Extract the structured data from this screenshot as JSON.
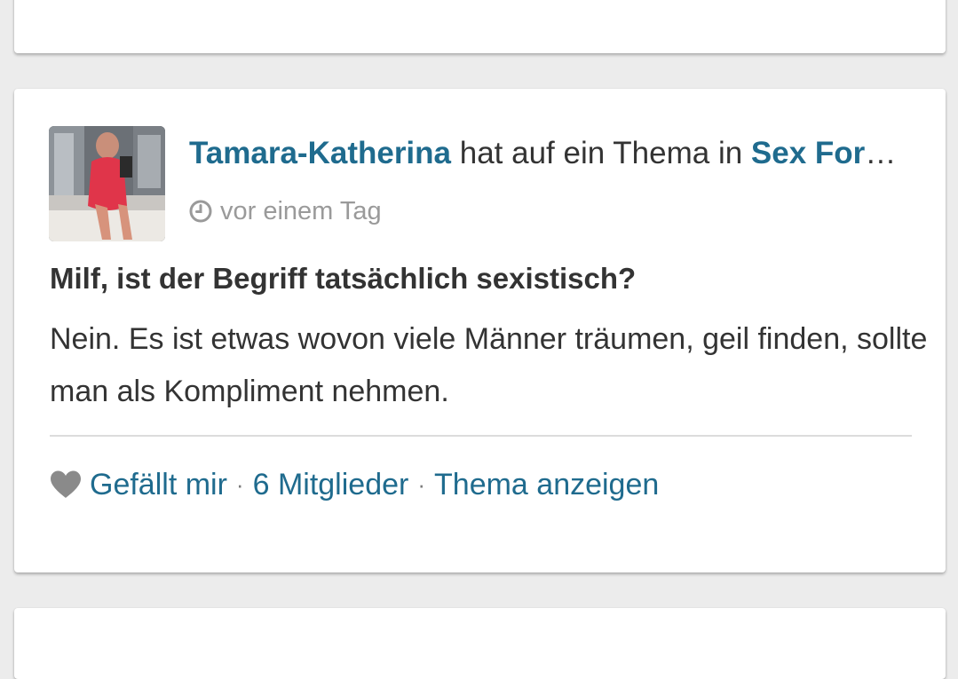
{
  "post": {
    "author": "Tamara-Katherina",
    "action_text": " hat auf ein Thema in ",
    "forum": "Sex Forum",
    "timestamp": "vor einem Tag",
    "title": "Milf, ist der Begriff tatsächlich sexistisch?",
    "body": "Nein. Es ist etwas wovon viele Männer träumen, geil finden, sollte man als Kompliment nehmen."
  },
  "actions": {
    "like_label": "Gefällt mir",
    "separator": "·",
    "members_label": "6 Mitglieder",
    "view_topic_label": "Thema anzeigen"
  },
  "icons": {
    "clock": "clock-icon",
    "heart": "heart-icon"
  },
  "colors": {
    "link": "#1f6b8e",
    "text": "#333333",
    "muted": "#9a9a9a",
    "background": "#ececec",
    "card": "#ffffff"
  }
}
